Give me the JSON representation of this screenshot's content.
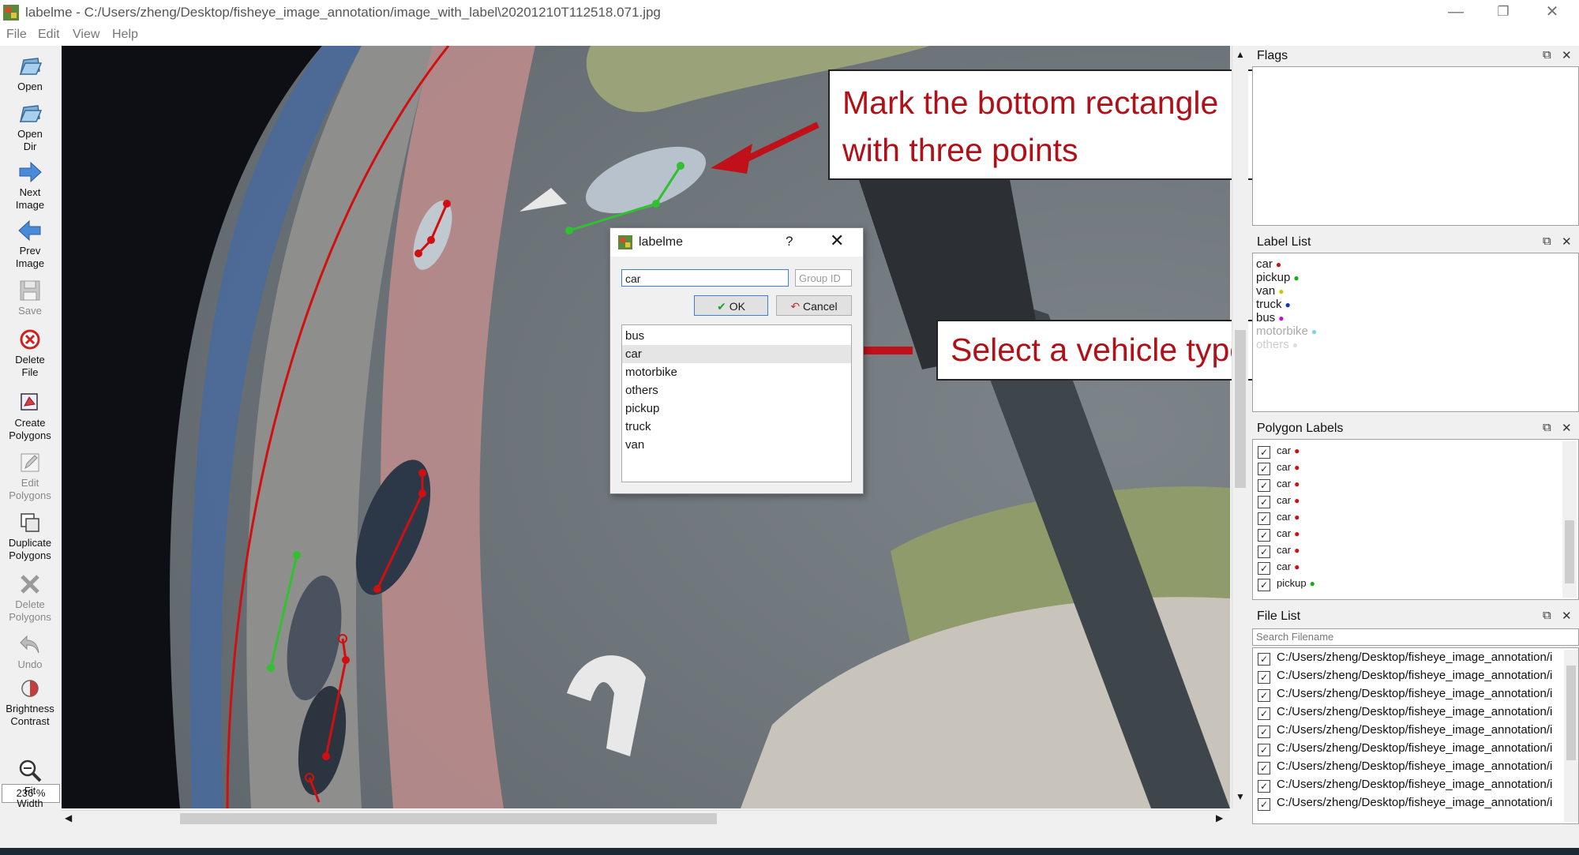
{
  "window": {
    "title": "labelme - C:/Users/zheng/Desktop/fisheye_image_annotation/image_with_label\\20201210T112518.071.jpg",
    "controls": {
      "minimize": "—",
      "restore": "❐",
      "close": "✕"
    }
  },
  "menu": [
    "File",
    "Edit",
    "View",
    "Help"
  ],
  "toolbar": {
    "open": "Open",
    "open_dir_1": "Open",
    "open_dir_2": "Dir",
    "next_1": "Next",
    "next_2": "Image",
    "prev_1": "Prev",
    "prev_2": "Image",
    "save": "Save",
    "delete_file_1": "Delete",
    "delete_file_2": "File",
    "create_1": "Create",
    "create_2": "Polygons",
    "edit_1": "Edit",
    "edit_2": "Polygons",
    "duplicate_1": "Duplicate",
    "duplicate_2": "Polygons",
    "delete_poly_1": "Delete",
    "delete_poly_2": "Polygons",
    "undo": "Undo",
    "brightness_1": "Brightness",
    "brightness_2": "Contrast",
    "zoom": "236 %",
    "fit_1": "Fit",
    "fit_2": "Width"
  },
  "callouts": {
    "top_line1": "Mark the bottom rectangle",
    "top_line2": "with three points",
    "middle": "Select a vehicle type"
  },
  "dialog": {
    "title": "labelme",
    "help": "?",
    "input_value": "car",
    "group_placeholder": "Group ID",
    "ok": "OK",
    "cancel": "Cancel",
    "options": [
      "bus",
      "car",
      "motorbike",
      "others",
      "pickup",
      "truck",
      "van"
    ],
    "selected": "car"
  },
  "docks": {
    "flags": {
      "title": "Flags"
    },
    "label_list": {
      "title": "Label List",
      "items": [
        {
          "label": "car",
          "color": "#d01010"
        },
        {
          "label": "pickup",
          "color": "#10b010"
        },
        {
          "label": "van",
          "color": "#c8c810"
        },
        {
          "label": "truck",
          "color": "#1030c0"
        },
        {
          "label": "bus",
          "color": "#c010c0"
        },
        {
          "label": "motorbike",
          "color": "#80d0f0"
        },
        {
          "label": "others",
          "color": "#c0c0c0"
        }
      ]
    },
    "polygon_labels": {
      "title": "Polygon Labels",
      "items": [
        {
          "label": "car",
          "color": "#d01010"
        },
        {
          "label": "car",
          "color": "#d01010"
        },
        {
          "label": "car",
          "color": "#d01010"
        },
        {
          "label": "car",
          "color": "#d01010"
        },
        {
          "label": "car",
          "color": "#d01010"
        },
        {
          "label": "car",
          "color": "#d01010"
        },
        {
          "label": "car",
          "color": "#d01010"
        },
        {
          "label": "car",
          "color": "#d01010"
        },
        {
          "label": "pickup",
          "color": "#10b010"
        }
      ]
    },
    "file_list": {
      "title": "File List",
      "search_placeholder": "Search Filename",
      "items": [
        "C:/Users/zheng/Desktop/fisheye_image_annotation/i",
        "C:/Users/zheng/Desktop/fisheye_image_annotation/i",
        "C:/Users/zheng/Desktop/fisheye_image_annotation/i",
        "C:/Users/zheng/Desktop/fisheye_image_annotation/i",
        "C:/Users/zheng/Desktop/fisheye_image_annotation/i",
        "C:/Users/zheng/Desktop/fisheye_image_annotation/i",
        "C:/Users/zheng/Desktop/fisheye_image_annotation/i",
        "C:/Users/zheng/Desktop/fisheye_image_annotation/i",
        "C:/Users/zheng/Desktop/fisheye_image_annotation/i"
      ]
    }
  },
  "colors": {
    "annotation_red": "#d01010",
    "annotation_green": "#30c030",
    "callout_text": "#b01018",
    "arrow": "#c0101a"
  }
}
